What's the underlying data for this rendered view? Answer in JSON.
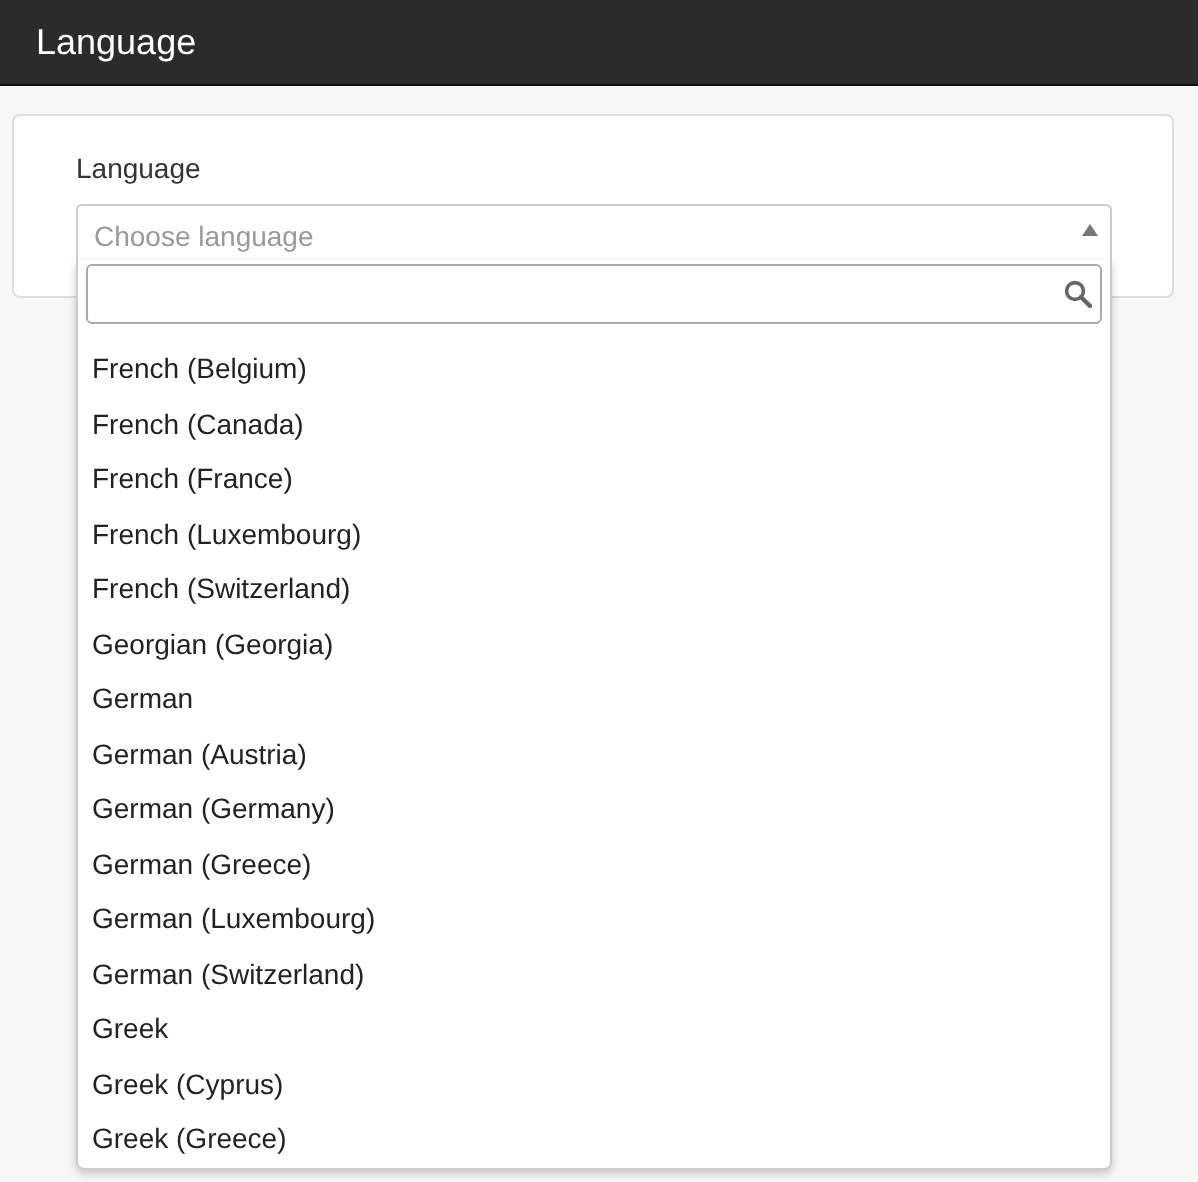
{
  "header": {
    "title": "Language"
  },
  "form": {
    "label": "Language",
    "select": {
      "placeholder": "Choose language",
      "expanded": true
    },
    "options": [
      {
        "label": "French (Belgium)",
        "selected": false
      },
      {
        "label": "French (Canada)",
        "selected": false
      },
      {
        "label": "French (France)",
        "selected": false
      },
      {
        "label": "French (Luxembourg)",
        "selected": false
      },
      {
        "label": "French (Switzerland)",
        "selected": false
      },
      {
        "label": "Georgian (Georgia)",
        "selected": false
      },
      {
        "label": "German",
        "selected": false
      },
      {
        "label": "German (Austria)",
        "selected": false
      },
      {
        "label": "German (Germany)",
        "selected": false
      },
      {
        "label": "German (Greece)",
        "selected": false
      },
      {
        "label": "German (Luxembourg)",
        "selected": false
      },
      {
        "label": "German (Switzerland)",
        "selected": false
      },
      {
        "label": "Greek",
        "selected": false
      },
      {
        "label": "Greek (Cyprus)",
        "selected": false
      },
      {
        "label": "Greek (Greece)",
        "selected": false
      }
    ]
  }
}
